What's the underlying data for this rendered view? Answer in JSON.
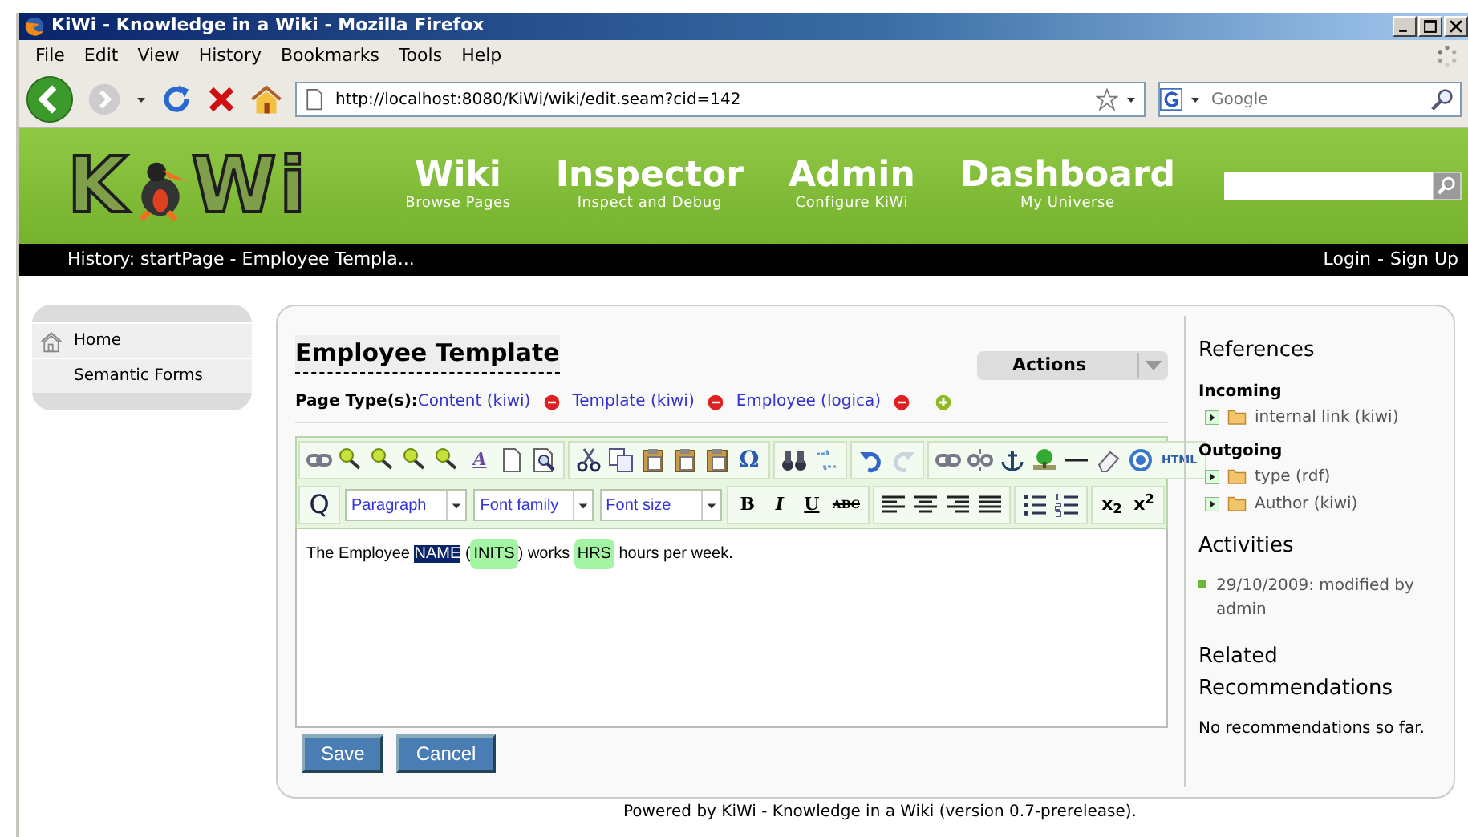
{
  "window": {
    "title": "KiWi - Knowledge in a Wiki - Mozilla Firefox"
  },
  "menu": [
    "File",
    "Edit",
    "View",
    "History",
    "Bookmarks",
    "Tools",
    "Help"
  ],
  "address": {
    "value": "http://localhost:8080/KiWi/wiki/edit.seam?cid=142"
  },
  "web_search": {
    "placeholder": "Google"
  },
  "logo": {
    "left": "K",
    "right": "Wi"
  },
  "nav": [
    {
      "title": "Wiki",
      "subtitle": "Browse Pages"
    },
    {
      "title": "Inspector",
      "subtitle": "Inspect and Debug"
    },
    {
      "title": "Admin",
      "subtitle": "Configure KiWi"
    },
    {
      "title": "Dashboard",
      "subtitle": "My Universe"
    }
  ],
  "history": "History: startPage - Employee Templa...",
  "account": [
    "Login",
    "-",
    "Sign Up"
  ],
  "sidebar": [
    {
      "label": "Home",
      "kind": "home"
    },
    {
      "label": "Semantic Forms",
      "kind": "plain"
    }
  ],
  "page": {
    "title": "Employee Template",
    "actions": "Actions",
    "types_label": "Page Type(s):",
    "types": [
      "Content (kiwi)",
      "Template (kiwi)",
      "Employee (logica)"
    ]
  },
  "editor": {
    "text_buttons": [
      "A",
      "Ω",
      "HTML",
      "Q",
      "B",
      "I",
      "U",
      "ABC",
      "x$_{2}$",
      "x$^{2}$"
    ],
    "selects": [
      "Paragraph",
      "Font family",
      "Font size"
    ],
    "content": [
      {
        "kind": "text",
        "text": "The Employee "
      },
      {
        "kind": "selected",
        "text": "NAME"
      },
      {
        "kind": "text",
        "text": " ("
      },
      {
        "kind": "field",
        "text": "INITS"
      },
      {
        "kind": "text",
        "text": ") works "
      },
      {
        "kind": "field",
        "text": "HRS"
      },
      {
        "kind": "text",
        "text": " hours per week."
      }
    ]
  },
  "buttons": [
    "Save",
    "Cancel"
  ],
  "references": {
    "title": "References",
    "groups": [
      {
        "title": "Incoming",
        "items": [
          "internal link (kiwi)"
        ]
      },
      {
        "title": "Outgoing",
        "items": [
          "type (rdf)",
          "Author (kiwi)"
        ]
      }
    ]
  },
  "activities": {
    "title": "Activities",
    "items": [
      "29/10/2009: modified by admin"
    ]
  },
  "recommendations": {
    "title": "Related Recommendations",
    "text": "No recommendations so far."
  },
  "footer": {
    "before": "Powered by ",
    "link": "KiWi - Knowledge in a Wiki",
    "after": " (version 0.7-prerelease)."
  }
}
